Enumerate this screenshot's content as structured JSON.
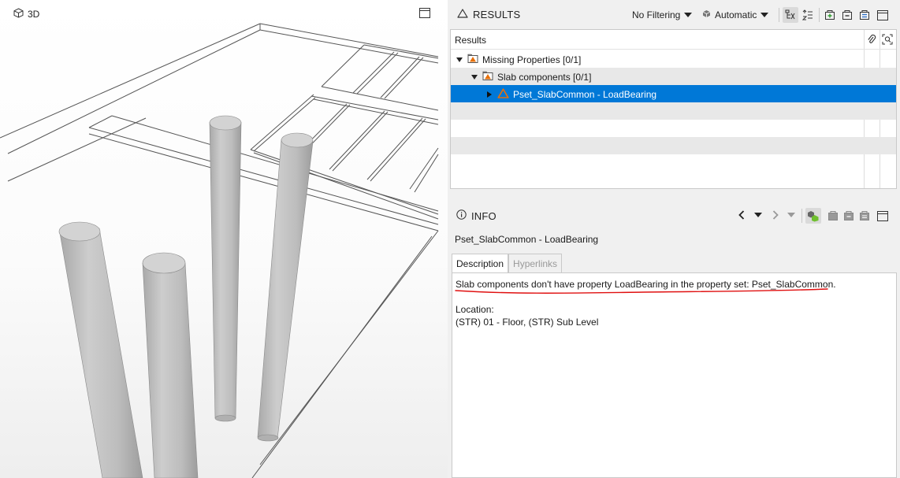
{
  "view3d": {
    "title": "3D",
    "icons": {
      "view": "cube-icon",
      "maximize": "window-maximize-icon"
    }
  },
  "results": {
    "title": "RESULTS",
    "filter_label": "No Filtering",
    "mode_label": "Automatic",
    "column_header": "Results",
    "rows": [
      {
        "label": "Missing Properties [0/1]",
        "level": 0,
        "expanded": true
      },
      {
        "label": "Slab components [0/1]",
        "level": 1,
        "expanded": true
      },
      {
        "label": "Pset_SlabCommon - LoadBearing",
        "level": 2,
        "expanded": false,
        "selected": true
      }
    ]
  },
  "info": {
    "title": "INFO",
    "subject": "Pset_SlabCommon - LoadBearing",
    "tabs": [
      "Description",
      "Hyperlinks"
    ],
    "active_tab": "Description",
    "description": "Slab components don't have property LoadBearing in the property set: Pset_SlabCommon.",
    "location_label": "Location:",
    "location_value": "(STR) 01 - Floor, (STR) Sub Level"
  },
  "colors": {
    "selection": "#0078d7",
    "warning_orange": "#e8700a",
    "underline_red": "#e01010",
    "add_green": "#2e9a2e",
    "fit_green": "#6fbf2e"
  }
}
